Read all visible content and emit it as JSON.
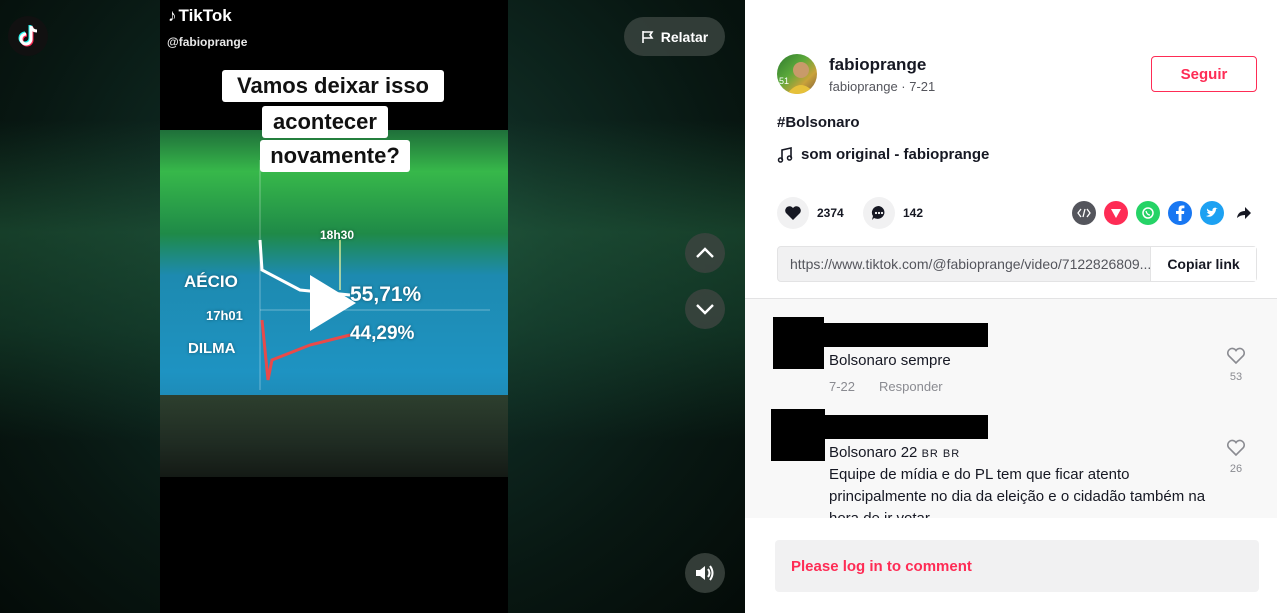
{
  "video": {
    "watermark_brand": "TikTok",
    "watermark_user": "@fabioprange",
    "report_label": "Relatar",
    "caption_lines": [
      "Vamos deixar isso",
      "acontecer",
      "novamente?"
    ],
    "overlay": {
      "time_top": "18h30",
      "candidate_1": "AÉCIO",
      "time_left": "17h01",
      "candidate_2": "DILMA",
      "percent_1": "55,71%",
      "percent_2": "44,29%"
    }
  },
  "author": {
    "username": "fabioprange",
    "sub_line": "fabioprange · 7-21",
    "follow_label": "Seguir"
  },
  "post": {
    "hashtag": "#Bolsonaro",
    "music": "som original - fabioprange",
    "likes": "2374",
    "comments": "142",
    "link": "https://www.tiktok.com/@fabioprange/video/7122826809...",
    "copy_label": "Copiar link"
  },
  "comment_list": [
    {
      "text": "Bolsonaro sempre",
      "date": "7-22",
      "reply_label": "Responder",
      "likes": "53"
    },
    {
      "text": "Bolsonaro 22",
      "tags": "BR BR",
      "body": "Equipe de mídia e do PL tem que ficar atento principalmente no dia da eleição e o cidadão também na hora de ir votar",
      "likes": "26"
    }
  ],
  "login_prompt": "Please log in to comment",
  "colors": {
    "brand_red": "#fe2c55",
    "text_dark": "#161823",
    "text_muted": "#8a8b91"
  },
  "icons": [
    "tiktok-logo-icon",
    "flag-icon",
    "chevron-up-icon",
    "chevron-down-icon",
    "speaker-icon",
    "play-icon",
    "music-note-icon",
    "heart-icon",
    "comment-icon",
    "embed-icon",
    "send-icon",
    "whatsapp-icon",
    "facebook-icon",
    "twitter-icon",
    "share-arrow-icon"
  ]
}
